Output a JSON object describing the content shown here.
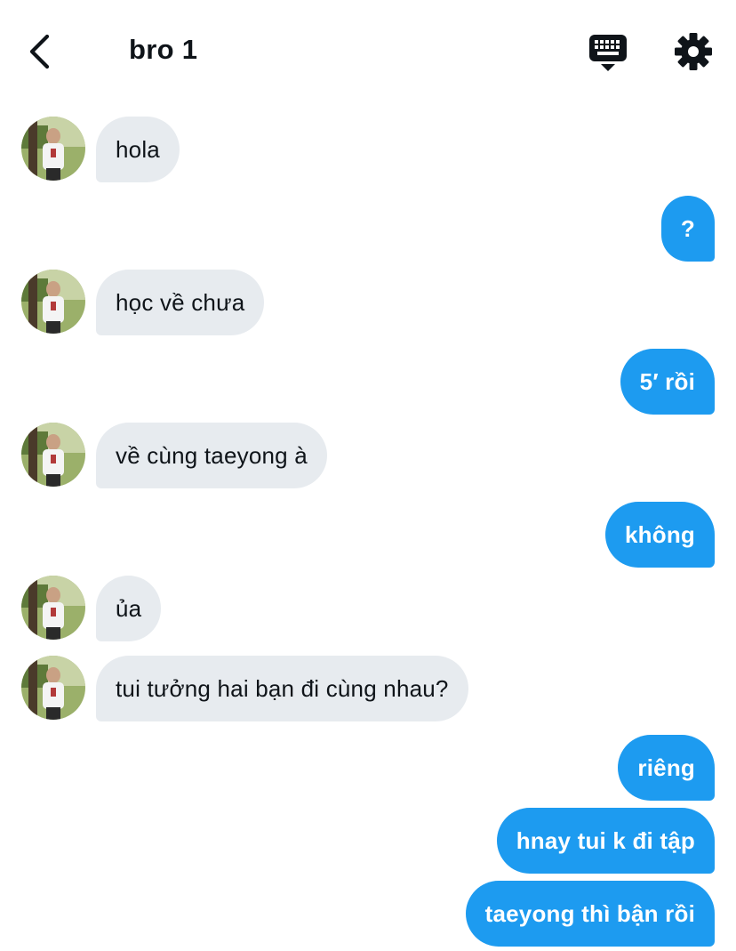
{
  "header": {
    "title": "bro 1",
    "back_icon": "chevron-left-icon",
    "keyboard_icon": "keyboard-icon",
    "settings_icon": "gear-icon"
  },
  "colors": {
    "incoming_bubble": "#e7ebef",
    "outgoing_bubble": "#1d9bf0",
    "text_dark": "#0f1419",
    "text_light": "#ffffff"
  },
  "messages": [
    {
      "direction": "incoming",
      "text": "hola"
    },
    {
      "direction": "outgoing",
      "text": "?"
    },
    {
      "direction": "incoming",
      "text": "học về chưa"
    },
    {
      "direction": "outgoing",
      "text": "5′ rồi"
    },
    {
      "direction": "incoming",
      "text": "về cùng taeyong à"
    },
    {
      "direction": "outgoing",
      "text": "không"
    },
    {
      "direction": "incoming",
      "text": "ủa"
    },
    {
      "direction": "incoming",
      "text": "tui tưởng hai bạn đi cùng nhau?"
    },
    {
      "direction": "outgoing",
      "text": "riêng"
    },
    {
      "direction": "outgoing",
      "text": "hnay tui k đi tập"
    },
    {
      "direction": "outgoing",
      "text": "taeyong thì bận rồi"
    }
  ]
}
